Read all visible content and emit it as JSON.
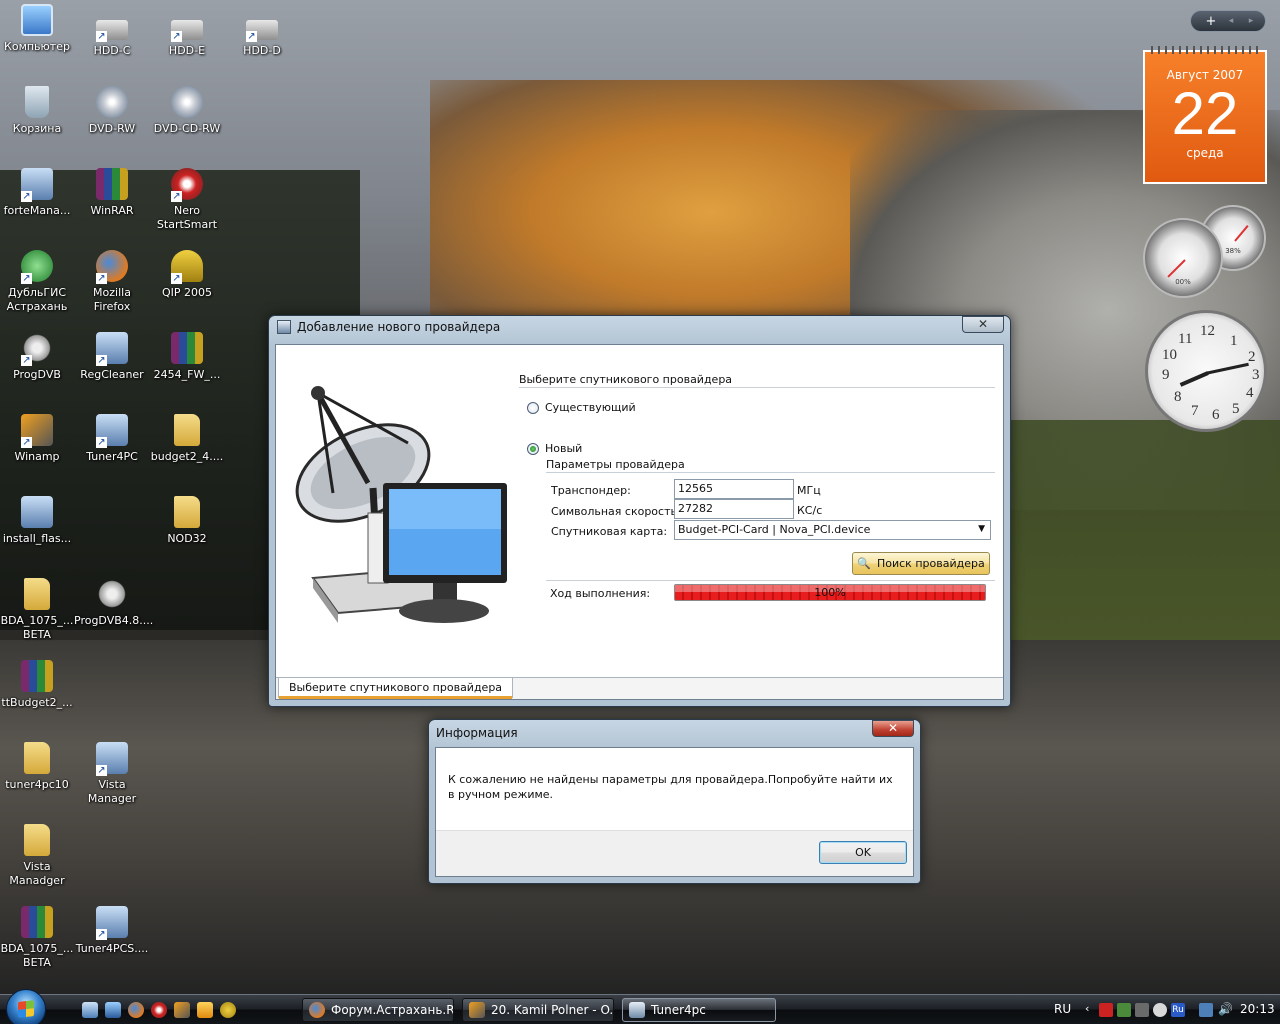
{
  "desktop": {
    "icons": [
      {
        "label": "Компьютер",
        "icon": "computer-icon"
      },
      {
        "label": "HDD-C",
        "icon": "drive-shortcut-icon"
      },
      {
        "label": "HDD-E",
        "icon": "drive-shortcut-icon"
      },
      {
        "label": "HDD-D",
        "icon": "drive-shortcut-icon"
      },
      {
        "label": "Корзина",
        "icon": "recycle-bin-icon"
      },
      {
        "label": "DVD-RW",
        "icon": "dvd-drive-icon"
      },
      {
        "label": "DVD-CD-RW",
        "icon": "cd-drive-icon"
      },
      {
        "label": "forteMana...",
        "icon": "app-shortcut-icon"
      },
      {
        "label": "WinRAR",
        "icon": "winrar-icon"
      },
      {
        "label": "Nero StartSmart",
        "icon": "nero-icon"
      },
      {
        "label": "ДубльГИС Астрахань",
        "icon": "dublgis-icon"
      },
      {
        "label": "Mozilla Firefox",
        "icon": "firefox-icon"
      },
      {
        "label": "QIP 2005",
        "icon": "qip-icon"
      },
      {
        "label": "ProgDVB",
        "icon": "satellite-dish-icon"
      },
      {
        "label": "RegCleaner",
        "icon": "app-shortcut-icon"
      },
      {
        "label": "2454_FW_...",
        "icon": "winrar-icon"
      },
      {
        "label": "Winamp",
        "icon": "winamp-icon"
      },
      {
        "label": "Tuner4PC",
        "icon": "app-shortcut-icon"
      },
      {
        "label": "budget2_4....",
        "icon": "folder-icon"
      },
      {
        "label": "install_flas...",
        "icon": "installer-icon"
      },
      {
        "label": "NOD32",
        "icon": "folder-icon"
      },
      {
        "label": "BDA_1075_... BETA",
        "icon": "folder-icon"
      },
      {
        "label": "ProgDVB4.8....",
        "icon": "satellite-dish-icon"
      },
      {
        "label": "ttBudget2_...",
        "icon": "winrar-icon"
      },
      {
        "label": "tuner4pc10",
        "icon": "folder-icon"
      },
      {
        "label": "Vista Manager",
        "icon": "app-shortcut-icon"
      },
      {
        "label": "Vista Manadger",
        "icon": "folder-icon"
      },
      {
        "label": "BDA_1075_... BETA",
        "icon": "winrar-icon"
      },
      {
        "label": "Tuner4PCS....",
        "icon": "app-shortcut-icon"
      }
    ]
  },
  "sidebar": {
    "add_label": "+",
    "prev_label": "◂",
    "next_label": "▸",
    "calendar": {
      "month_year": "Август 2007",
      "day": "22",
      "weekday": "среда"
    },
    "cpu_meter": {
      "cpu_value": "00%",
      "mem_value": "38%"
    },
    "clock": {
      "hour": 8,
      "minute": 13
    }
  },
  "provider_window": {
    "title": "Добавление нового провайдера",
    "close_label": "✕",
    "section_title": "Выберите спутникового провайдера",
    "radio_existing": "Существующий",
    "radio_new": "Новый",
    "params_title": "Параметры провайдера",
    "transponder_label": "Транспондер:",
    "transponder_value": "12565",
    "transponder_unit": "МГц",
    "symbol_rate_label": "Символьная скорость:",
    "symbol_rate_value": "27282",
    "symbol_rate_unit": "КС/с",
    "card_label": "Спутниковая карта:",
    "card_value": "Budget-PCI-Card | Nova_PCI.device",
    "search_button": "Поиск провайдера",
    "progress_label": "Ход выполнения:",
    "progress_value": 1.0,
    "progress_text": "100%",
    "tab_label": "Выберите спутникового провайдера"
  },
  "info_dialog": {
    "title": "Информация",
    "close_label": "✕",
    "message": "К сожалению не найдены параметры для провайдера.Попробуйте найти их в ручном режиме.",
    "ok_label": "OK"
  },
  "taskbar": {
    "tasks": [
      {
        "label": "Форум.Астрахань.R...",
        "icon": "firefox-icon"
      },
      {
        "label": "20. Kamil Polner - O...",
        "icon": "winamp-icon"
      },
      {
        "label": "Tuner4pc",
        "icon": "app-icon"
      }
    ],
    "language": "RU",
    "tray_lang": "Ru",
    "time": "20:13"
  }
}
